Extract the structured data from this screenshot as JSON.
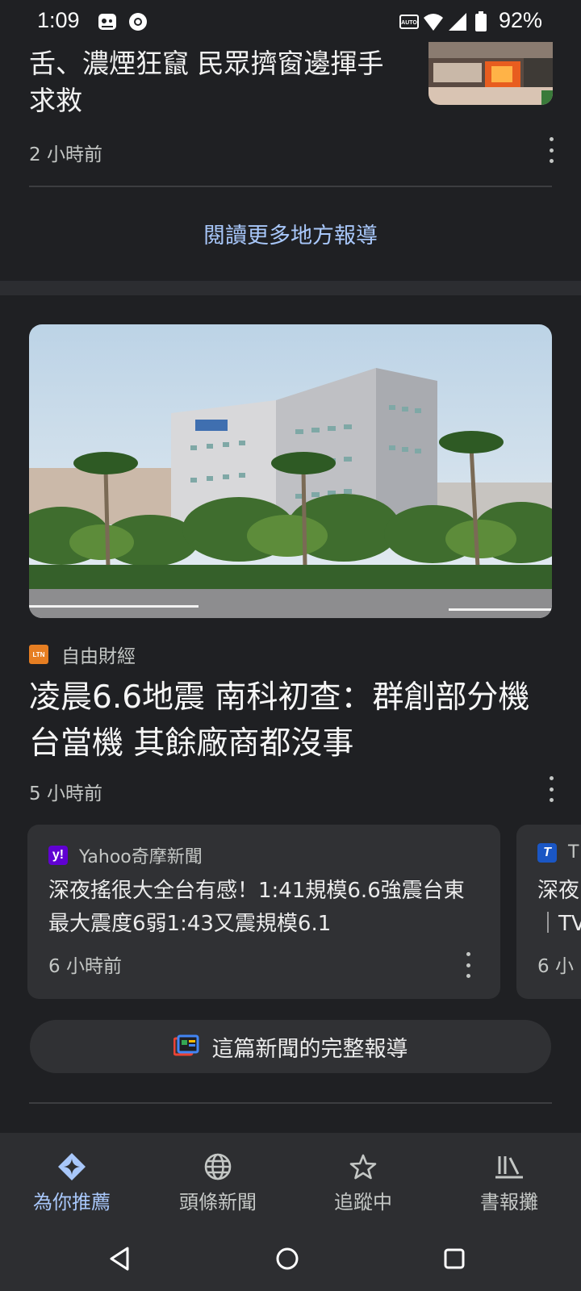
{
  "status_bar": {
    "time": "1:09",
    "battery": "92%",
    "icons": [
      "game-controller-icon",
      "chrome-icon",
      "auto-hz-icon",
      "wifi-icon",
      "cellular-signal-icon",
      "battery-icon"
    ]
  },
  "top_article": {
    "title": "舌、濃煙狂竄 民眾擠窗邊揮手求救",
    "time": "2 小時前",
    "thumbnail": "building-fire-photo",
    "read_more": "閱讀更多地方報導"
  },
  "main_article": {
    "image": "factory-building-photo",
    "source": "自由財經",
    "source_logo_text": "LTN",
    "title": "凌晨6.6地震 南科初查：群創部分機台當機 其餘廠商都沒事",
    "time": "5 小時前"
  },
  "related": [
    {
      "source": "Yahoo奇摩新聞",
      "logo_text": "y!",
      "title": "深夜搖很大全台有感！1:41規模6.6強震台東最大震度6弱1:43又震規模6.1",
      "time": "6 小時前"
    },
    {
      "source": "T",
      "logo_text": "T",
      "title": "深夜｜TV",
      "time": "6 小"
    }
  ],
  "full_coverage": {
    "label": "這篇新聞的完整報導"
  },
  "bottom_nav": [
    {
      "label": "為你推薦",
      "icon": "sparkle-icon",
      "active": true
    },
    {
      "label": "頭條新聞",
      "icon": "globe-icon",
      "active": false
    },
    {
      "label": "追蹤中",
      "icon": "star-icon",
      "active": false
    },
    {
      "label": "書報攤",
      "icon": "newsstand-icon",
      "active": false
    }
  ],
  "colors": {
    "background": "#1f2023",
    "card": "#303134",
    "accent": "#a8c7fa",
    "text_secondary": "#c4c7c5"
  }
}
